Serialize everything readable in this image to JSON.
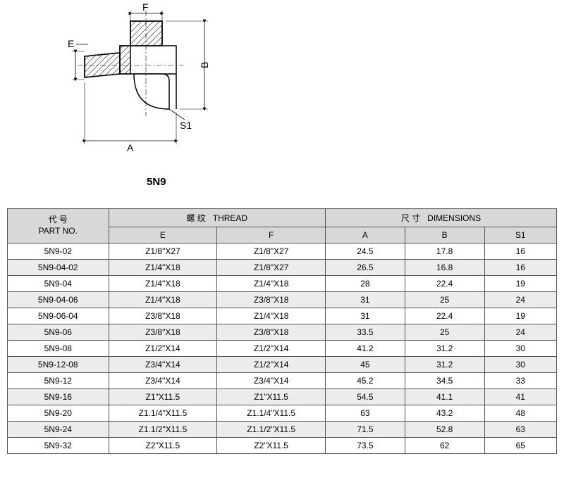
{
  "part_label": "5N9",
  "diagram_labels": {
    "E": "E",
    "F": "F",
    "A": "A",
    "B": "B",
    "S1": "S1"
  },
  "table": {
    "header": {
      "part_no_cn": "代  号",
      "part_no_en": "PART NO.",
      "thread_cn": "螺  纹",
      "thread_en": "THREAD",
      "dim_cn": "尺  寸",
      "dim_en": "DIMENSIONS",
      "E": "E",
      "F": "F",
      "A": "A",
      "B": "B",
      "S1": "S1"
    },
    "rows": [
      {
        "part": "5N9-02",
        "E": "Z1/8\"X27",
        "F": "Z1/8\"X27",
        "A": "24.5",
        "B": "17.8",
        "S1": "16"
      },
      {
        "part": "5N9-04-02",
        "E": "Z1/4\"X18",
        "F": "Z1/8\"X27",
        "A": "26.5",
        "B": "16.8",
        "S1": "16"
      },
      {
        "part": "5N9-04",
        "E": "Z1/4\"X18",
        "F": "Z1/4\"X18",
        "A": "28",
        "B": "22.4",
        "S1": "19"
      },
      {
        "part": "5N9-04-06",
        "E": "Z1/4\"X18",
        "F": "Z3/8\"X18",
        "A": "31",
        "B": "25",
        "S1": "24"
      },
      {
        "part": "5N9-06-04",
        "E": "Z3/8\"X18",
        "F": "Z1/4\"X18",
        "A": "31",
        "B": "22.4",
        "S1": "19"
      },
      {
        "part": "5N9-06",
        "E": "Z3/8\"X18",
        "F": "Z3/8\"X18",
        "A": "33.5",
        "B": "25",
        "S1": "24"
      },
      {
        "part": "5N9-08",
        "E": "Z1/2\"X14",
        "F": "Z1/2\"X14",
        "A": "41.2",
        "B": "31.2",
        "S1": "30"
      },
      {
        "part": "5N9-12-08",
        "E": "Z3/4\"X14",
        "F": "Z1/2\"X14",
        "A": "45",
        "B": "31.2",
        "S1": "30"
      },
      {
        "part": "5N9-12",
        "E": "Z3/4\"X14",
        "F": "Z3/4\"X14",
        "A": "45.2",
        "B": "34.5",
        "S1": "33"
      },
      {
        "part": "5N9-16",
        "E": "Z1\"X11.5",
        "F": "Z1\"X11.5",
        "A": "54.5",
        "B": "41.1",
        "S1": "41"
      },
      {
        "part": "5N9-20",
        "E": "Z1.1/4\"X11.5",
        "F": "Z1.1/4\"X11.5",
        "A": "63",
        "B": "43.2",
        "S1": "48"
      },
      {
        "part": "5N9-24",
        "E": "Z1.1/2\"X11.5",
        "F": "Z1.1/2\"X11.5",
        "A": "71.5",
        "B": "52.8",
        "S1": "63"
      },
      {
        "part": "5N9-32",
        "E": "Z2\"X11.5",
        "F": "Z2\"X11.5",
        "A": "73.5",
        "B": "62",
        "S1": "65"
      }
    ]
  }
}
